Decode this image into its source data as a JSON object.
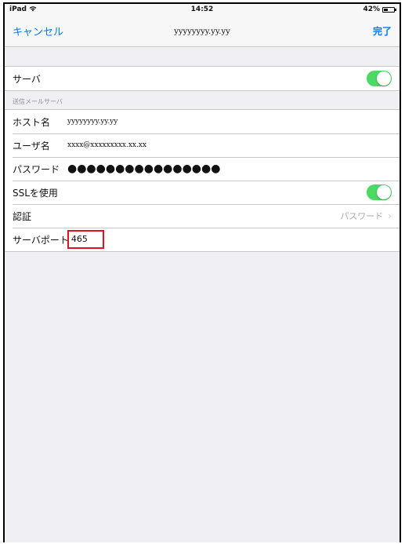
{
  "status_bar": {
    "device": "iPad",
    "wifi_icon": "wifi-icon",
    "time": "14:52",
    "battery_percent": "42%",
    "battery_level": 0.42
  },
  "nav": {
    "cancel_label": "キャンセル",
    "title": "yyyyyyyy.yy.yy",
    "done_label": "完了"
  },
  "server_group": {
    "label": "サーバ",
    "enabled": true
  },
  "outgoing_section": {
    "header": "送信メールサーバ",
    "host_label": "ホスト名",
    "host_value": "yyyyyyyy.yy.yy",
    "user_label": "ユーザ名",
    "user_value": "xxxx@xxxxxxxxx.xx.xx",
    "password_label": "パスワード",
    "password_value": "●●●●●●●●●●●●●●●●",
    "ssl_label": "SSLを使用",
    "ssl_enabled": true,
    "auth_label": "認証",
    "auth_value": "パスワード",
    "port_label": "サーバポート",
    "port_value": "465"
  },
  "colors": {
    "accent": "#007aff",
    "toggle_on": "#4cd964",
    "highlight_box": "#e0121c"
  }
}
